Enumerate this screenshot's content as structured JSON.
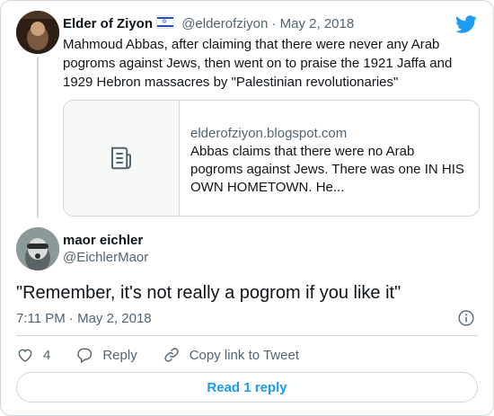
{
  "parent": {
    "name": "Elder of Ziyon",
    "handle": "@elderofziyon",
    "date": "May 2, 2018",
    "text": "Mahmoud Abbas, after claiming that there were never any Arab pogroms against Jews, then went on to praise the 1921 Jaffa and 1929 Hebron massacres by \"Palestinian revolutionaries\"",
    "avatar_text": "ELDER OF ZIYON",
    "flag": "israel-flag-icon",
    "link": {
      "domain": "elderofziyon.blogspot.com",
      "description": "Abbas claims that there were no Arab pogroms against Jews. There was one IN HIS OWN HOMETOWN. He...",
      "icon": "document-icon"
    }
  },
  "tweet": {
    "name": "maor eichler",
    "handle": "@EichlerMaor",
    "text": "\"Remember, it's not really a pogrom if you like it\"",
    "timestamp": "7:11 PM · May 2, 2018"
  },
  "actions": {
    "likes": "4",
    "reply_label": "Reply",
    "copy_label": "Copy link to Tweet"
  },
  "read_reply_label": "Read 1 reply",
  "colors": {
    "brand_blue": "#1d9bf0",
    "text": "#0f1419",
    "secondary": "#536471",
    "border": "#cfd9de"
  }
}
